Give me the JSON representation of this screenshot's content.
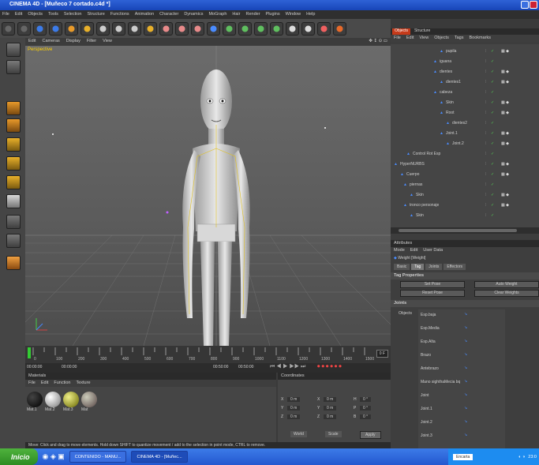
{
  "window": {
    "title": "CINEMA 4D - [Muñeco 7 cortado.c4d *]"
  },
  "menu": [
    "File",
    "Edit",
    "Objects",
    "Tools",
    "Selection",
    "Structure",
    "Functions",
    "Animation",
    "Character",
    "Dynamics",
    "MoGraph",
    "Hair",
    "Render",
    "Plugins",
    "Window",
    "Help"
  ],
  "viewport": {
    "menu": [
      "Edit",
      "Cameras",
      "Display",
      "Filter",
      "View"
    ],
    "label": "Perspective"
  },
  "timeline": {
    "ticks": [
      "0",
      "50",
      "100",
      "150",
      "200",
      "250",
      "300",
      "350",
      "400",
      "450",
      "500",
      "550",
      "600",
      "650",
      "700",
      "750",
      "800",
      "850",
      "900",
      "950",
      "1000",
      "1050",
      "1100",
      "1150",
      "1200",
      "1250",
      "1300",
      "1350",
      "1400",
      "1450",
      "1500"
    ],
    "frame_field": "0 F",
    "start": "00:00:00",
    "current": "00:00:00",
    "end1": "00:50:00",
    "end2": "00:50:00"
  },
  "materials": {
    "title": "Materials",
    "menu": [
      "File",
      "Edit",
      "Function",
      "Texture"
    ],
    "items": [
      "Mat.1",
      "Mat.2",
      "Mat.3",
      "Mat"
    ]
  },
  "coordinates": {
    "title": "Coordinates",
    "rows": [
      [
        "X",
        "0 m",
        "X",
        "0 m",
        "H",
        "0 °"
      ],
      [
        "Y",
        "0 m",
        "Y",
        "0 m",
        "P",
        "0 °"
      ],
      [
        "Z",
        "0 m",
        "Z",
        "0 m",
        "B",
        "0 °"
      ]
    ],
    "mode1": "World",
    "mode2": "Scale",
    "apply": "Apply"
  },
  "status": "Move: Click and drag to move elements. Hold down SHIFT to quantize movement / add to the selection in point mode, CTRL to remove.",
  "object_manager": {
    "tabs": [
      "Objects",
      "Structure"
    ],
    "menu": [
      "File",
      "Edit",
      "View",
      "Objects",
      "Tags",
      "Bookmarks"
    ],
    "rows": [
      {
        "indent": 62,
        "name": "pupila"
      },
      {
        "indent": 54,
        "name": "iguana"
      },
      {
        "indent": 54,
        "name": "dientes"
      },
      {
        "indent": 62,
        "name": "dientes1"
      },
      {
        "indent": 54,
        "name": "cabeza"
      },
      {
        "indent": 62,
        "name": "Skin"
      },
      {
        "indent": 62,
        "name": "Root"
      },
      {
        "indent": 70,
        "name": "dientes2"
      },
      {
        "indent": 62,
        "name": "Joint.1"
      },
      {
        "indent": 70,
        "name": "Joint.2"
      },
      {
        "indent": 20,
        "name": "Control Rot Esp"
      },
      {
        "indent": 4,
        "name": "HyperNURBS"
      },
      {
        "indent": 12,
        "name": "Cuerpo"
      },
      {
        "indent": 16,
        "name": "piernas"
      },
      {
        "indent": 24,
        "name": "Skin"
      },
      {
        "indent": 16,
        "name": "tronco personaje"
      },
      {
        "indent": 24,
        "name": "Skin"
      }
    ]
  },
  "attributes": {
    "title": "Attributes",
    "menu": [
      "Mode",
      "Edit",
      "User Data"
    ],
    "object": "Weight [Weight]",
    "tabs": [
      "Basic",
      "Tag",
      "Joints",
      "Effectors"
    ],
    "section": "Tag Properties",
    "buttons": [
      "Set Pose",
      "Auto Weight",
      "Reset Pose",
      "Clear Weights"
    ],
    "joints_label": "Joints",
    "objects_label": "Objects",
    "joints": [
      "Esp.baja",
      "Esp.Media",
      "Esp.Alta",
      "Brazo",
      "Antebrazo",
      "Mano sighthaMecia bq",
      "Joint",
      "Joint.1",
      "Joint.2",
      "Joint.3"
    ]
  },
  "taskbar": {
    "start": "Inicio",
    "tasks": [
      "CONTENIDO - MANU...",
      "CINEMA 4D - [Muñec..."
    ],
    "search": "Encarta",
    "time": "23:0"
  },
  "colors": {
    "accent": "#2e62d6",
    "viewport_label": "#ffd000",
    "selected_tab": "#5a5a5a",
    "object_icon": "#4a8cff",
    "joint_icon": "#4a8cff"
  }
}
